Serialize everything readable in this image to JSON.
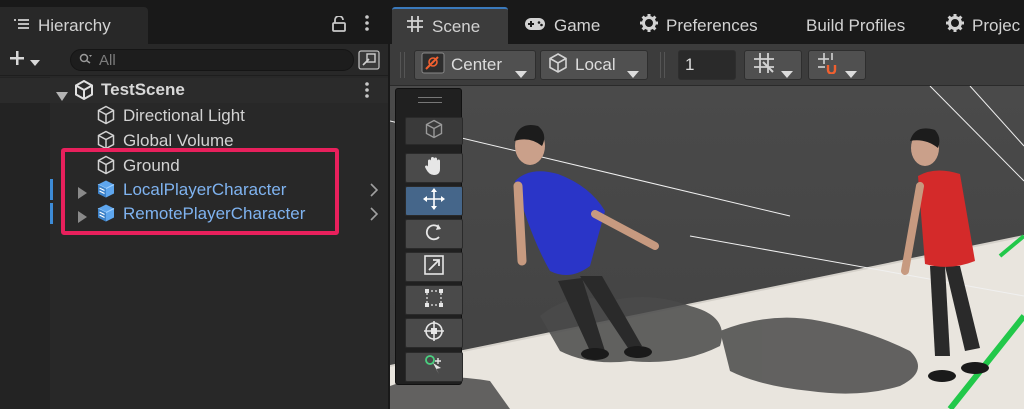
{
  "hierarchy": {
    "tab_label": "Hierarchy",
    "search_placeholder": "All",
    "scene": {
      "name": "TestScene"
    },
    "items": [
      {
        "label": "Directional Light",
        "type": "gameobject"
      },
      {
        "label": "Global Volume",
        "type": "gameobject"
      },
      {
        "label": "Ground",
        "type": "gameobject"
      },
      {
        "label": "LocalPlayerCharacter",
        "type": "prefab"
      },
      {
        "label": "RemotePlayerCharacter",
        "type": "prefab"
      }
    ]
  },
  "tabs": [
    {
      "label": "Scene",
      "icon": "hash-icon",
      "active": true
    },
    {
      "label": "Game",
      "icon": "gamepad-icon",
      "active": false
    },
    {
      "label": "Preferences",
      "icon": "gear-icon",
      "active": false
    },
    {
      "label": "Build Profiles",
      "icon": "",
      "active": false
    },
    {
      "label": "Projec",
      "icon": "gear-icon",
      "active": false
    }
  ],
  "scene_toolbar": {
    "pivot_mode": "Center",
    "pivot_rotation": "Local",
    "grid_value": "1"
  },
  "tools": [
    "view-tool",
    "hand-tool",
    "move-tool",
    "rotate-tool",
    "scale-tool",
    "rect-tool",
    "transform-tool",
    "custom-tool"
  ],
  "active_tool": "move-tool",
  "colors": {
    "selection_outline": "#e8205c",
    "prefab_text": "#7fb3f0",
    "active_tab_accent": "#3a79bb",
    "ground_grid": "#20c840"
  }
}
